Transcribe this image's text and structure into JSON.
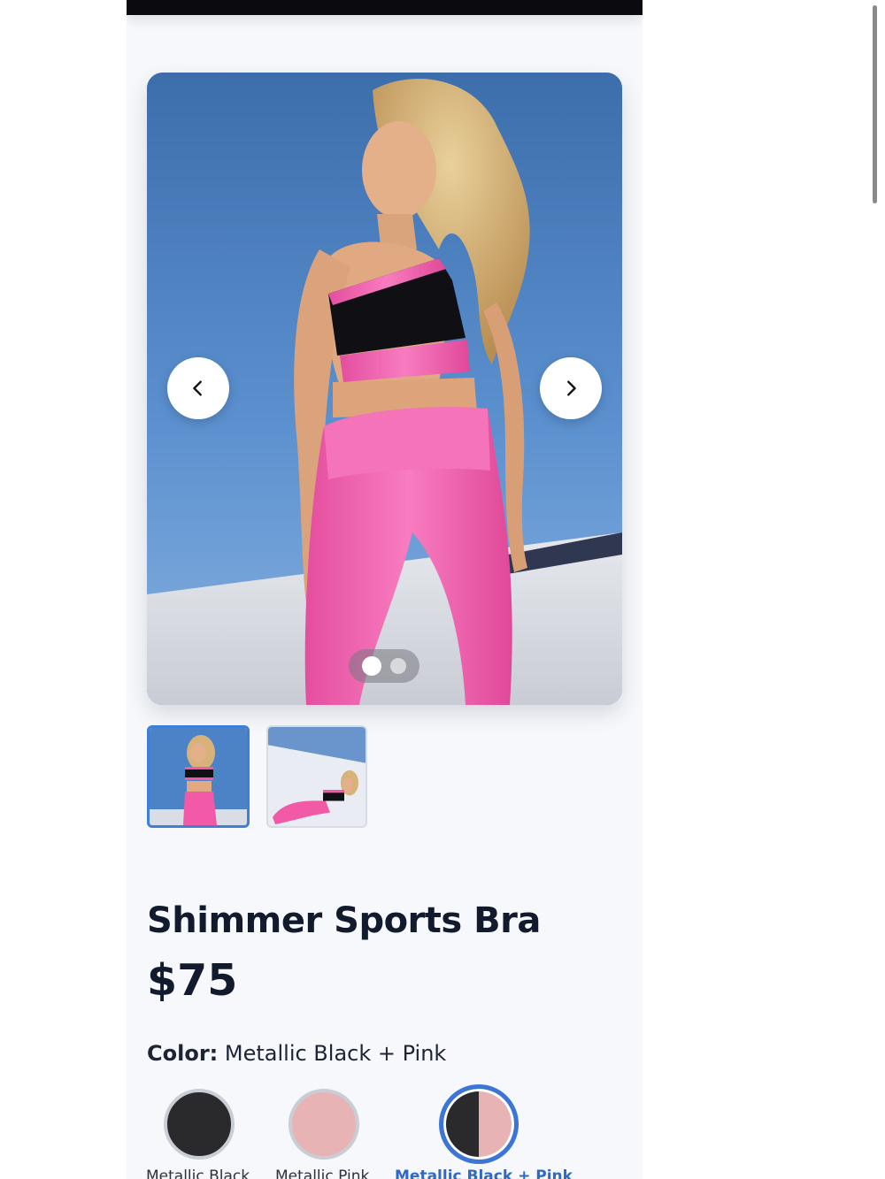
{
  "product": {
    "title": "Shimmer Sports Bra",
    "price": "$75",
    "color_label": "Color:",
    "color_value": "Metallic Black + Pink"
  },
  "gallery": {
    "image_count": 2,
    "active_index": 0,
    "prev_icon": "chevron-left-icon",
    "next_icon": "chevron-right-icon"
  },
  "swatches": [
    {
      "label": "Metallic Black",
      "color": "#2a2a2c",
      "selected": false
    },
    {
      "label": "Metallic Pink",
      "color": "#e8b3b5",
      "selected": false
    },
    {
      "label": "Metallic Black + Pink",
      "color": "#2a2a2c/#e8b3b5",
      "selected": true
    }
  ],
  "colors": {
    "accent": "#3b76d6",
    "text": "#121a2d",
    "pink": "#f25aa8"
  }
}
